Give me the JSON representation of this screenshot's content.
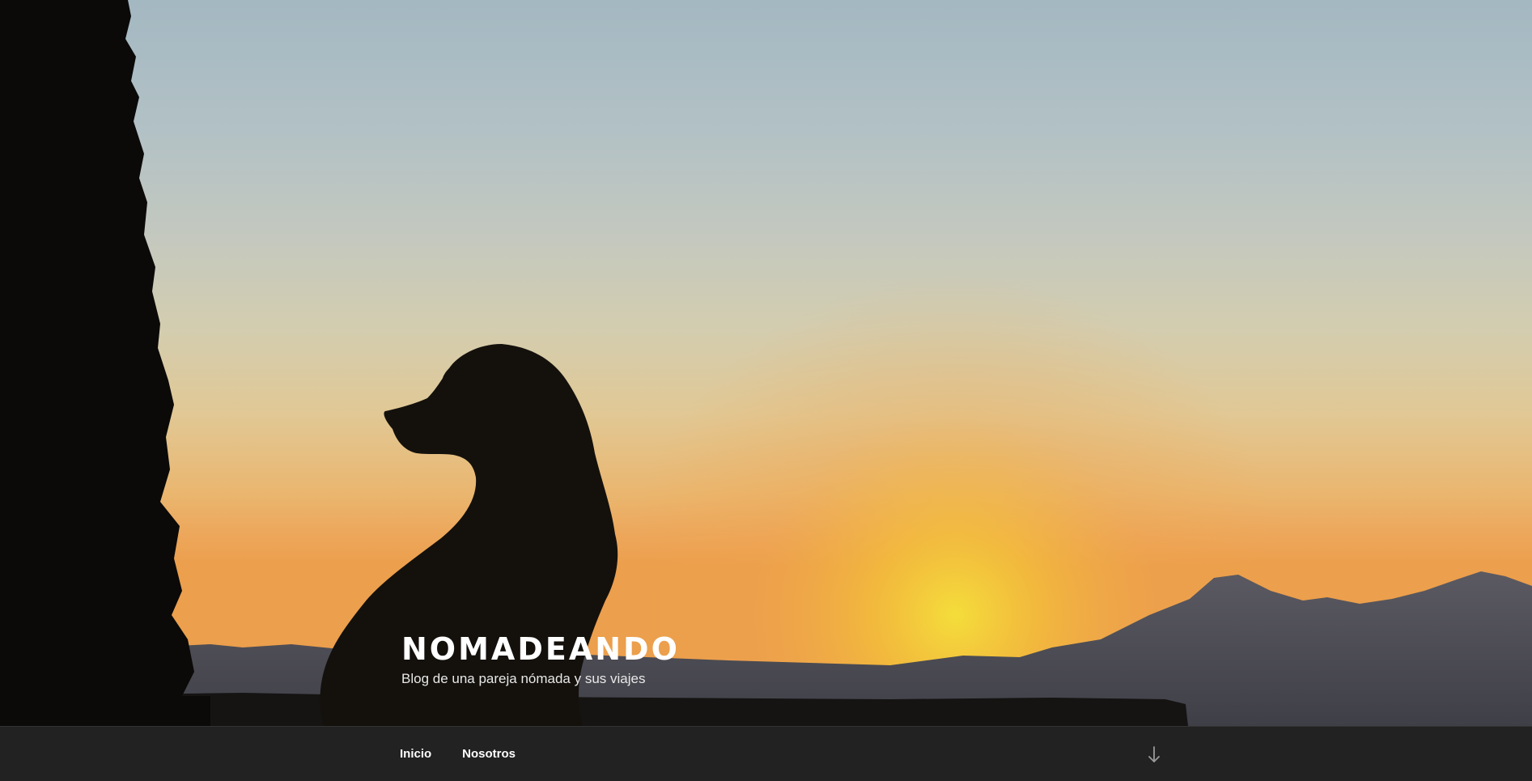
{
  "site": {
    "title": "NOMADEANDO",
    "description": "Blog de una pareja nómada y sus viajes"
  },
  "navigation": {
    "items": [
      {
        "label": "Inicio"
      },
      {
        "label": "Nosotros"
      }
    ],
    "scroll_icon": "arrow-down-icon"
  },
  "colors": {
    "nav_background": "#222222",
    "text": "#ffffff",
    "sky_top": "#a4b8c2",
    "sunset_glow": "#f0b84e"
  }
}
